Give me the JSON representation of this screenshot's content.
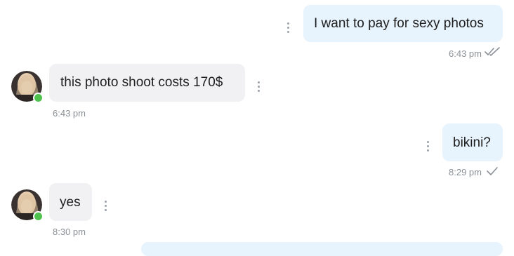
{
  "messages": [
    {
      "direction": "out",
      "text": "I want to pay for sexy photos",
      "time": "6:43 pm",
      "status_icon": "double-check-icon"
    },
    {
      "direction": "in",
      "text": "this photo shoot costs 170$",
      "time": "6:43 pm",
      "sender_online": true
    },
    {
      "direction": "out",
      "text": "bikini?",
      "time": "8:29 pm",
      "status_icon": "single-check-icon"
    },
    {
      "direction": "in",
      "text": "yes",
      "time": "8:30 pm",
      "sender_online": true
    }
  ],
  "colors": {
    "outgoing_bubble": "#e7f3fd",
    "incoming_bubble": "#f1f1f3",
    "online_indicator": "#4ec24c",
    "timestamp": "#8a9096"
  }
}
